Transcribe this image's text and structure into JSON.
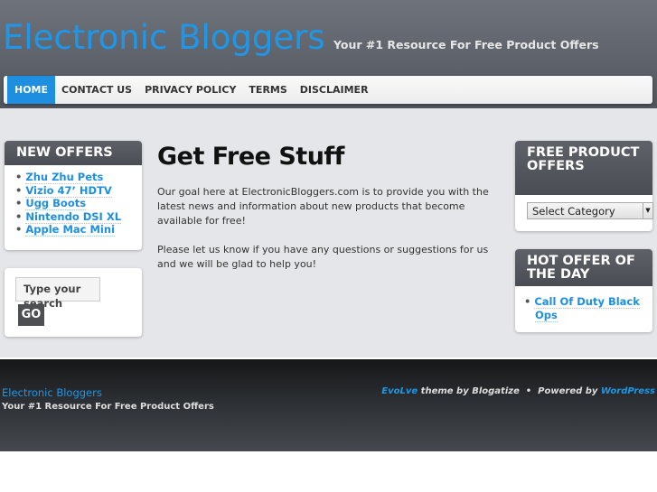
{
  "header": {
    "title": "Electronic Bloggers",
    "tagline": "Your #1 Resource For Free Product Offers"
  },
  "nav": [
    {
      "label": "HOME",
      "active": true
    },
    {
      "label": "CONTACT US"
    },
    {
      "label": "PRIVACY POLICY"
    },
    {
      "label": "TERMS"
    },
    {
      "label": "DISCLAIMER"
    }
  ],
  "left": {
    "new_offers": {
      "title": "NEW OFFERS",
      "items": [
        "Zhu Zhu Pets",
        "Vizio 47’ HDTV",
        "Ugg Boots",
        "Nintendo DSI XL",
        "Apple Mac Mini"
      ]
    },
    "search": {
      "placeholder": "Type your search",
      "button": "GO"
    }
  },
  "content": {
    "title": "Get Free Stuff",
    "paragraphs": [
      "Our goal here at ElectronicBloggers.com is to provide you with the latest news and information about new products that become available for free!",
      "Please let us know if you have any questions or suggestions for us and we will be glad to help you!"
    ]
  },
  "right": {
    "free_offers": {
      "title": "FREE PRODUCT OFFERS",
      "select": "Select Category"
    },
    "hot_offer": {
      "title": "HOT OFFER OF THE DAY",
      "items": [
        "Call Of Duty Black Ops"
      ]
    }
  },
  "footer": {
    "title": "Electronic Bloggers",
    "tagline": "Your #1 Resource For Free Product Offers",
    "theme": "EvoLve",
    "theme_by": " theme by Blogatize  •  Powered by ",
    "wordpress": "WordPress"
  },
  "colors": {
    "accent": "#1e8fe0",
    "header": "#5a5e66"
  }
}
